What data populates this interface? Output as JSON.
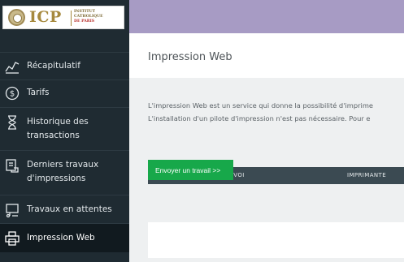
{
  "logo": {
    "name": "ICP",
    "subtitle_lines": [
      "INSTITUT",
      "CATHOLIQUE",
      "DE PARIS"
    ]
  },
  "sidebar": {
    "items": [
      {
        "label": "Récapitulatif",
        "icon": "chart-line-icon"
      },
      {
        "label": "Tarifs",
        "icon": "dollar-circle-icon"
      },
      {
        "label": "Historique des transactions",
        "icon": "hourglass-icon"
      },
      {
        "label": "Derniers travaux d'impressions",
        "icon": "print-job-icon"
      },
      {
        "label": "Travaux en attentes",
        "icon": "pending-print-icon"
      },
      {
        "label": "Impression Web",
        "icon": "printer-icon",
        "active": true
      }
    ]
  },
  "header": {
    "accent_color": "#a79bc4"
  },
  "main": {
    "title": "Impression Web",
    "description_line1": "L'impression Web est un service qui donne la possibilité d'imprime",
    "description_line2": "L'installation d'un pilote d'impression n'est pas nécessaire. Pour e",
    "send_button": "Envoyer un travail >>",
    "table_columns": [
      "HEURE D'ENVOI",
      "IMPRIMANTE"
    ]
  },
  "colors": {
    "sidebar_bg": "#1f2b32",
    "button_green": "#17a84a",
    "table_header_bg": "#3b4a52"
  }
}
